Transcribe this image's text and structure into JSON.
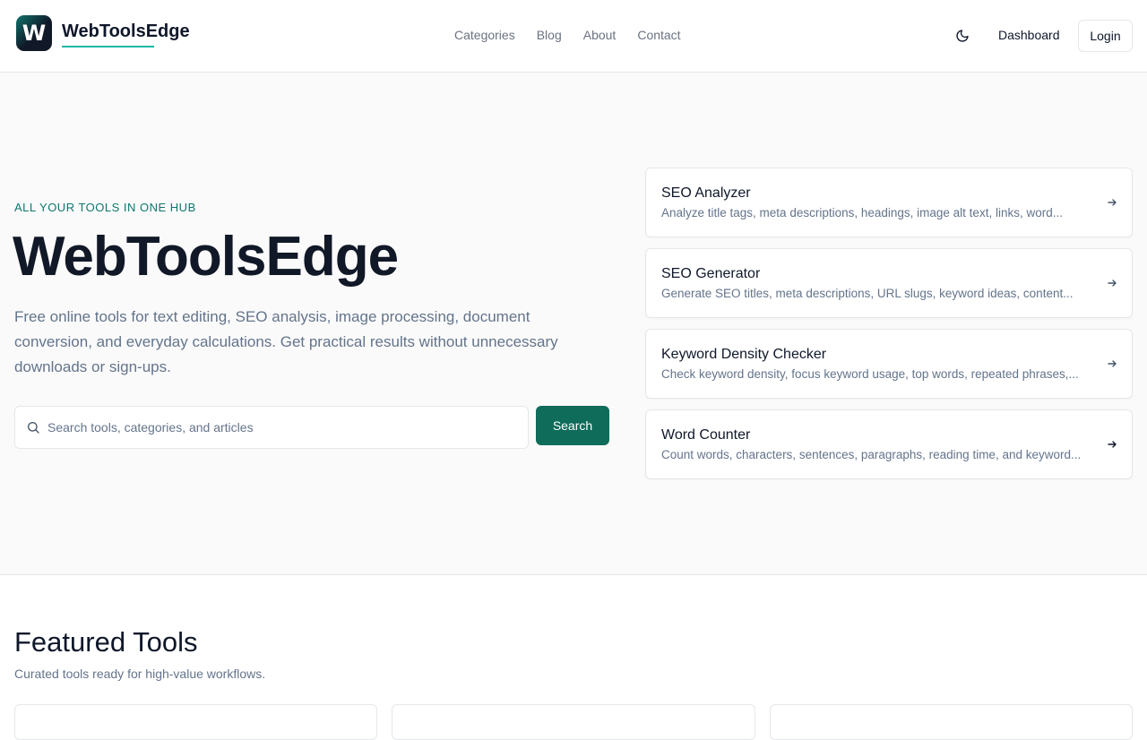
{
  "brand": {
    "logo_letter": "W",
    "name": "WebToolsEdge"
  },
  "nav": {
    "items": [
      "Categories",
      "Blog",
      "About",
      "Contact"
    ]
  },
  "header": {
    "theme_icon": "moon-icon",
    "dashboard_label": "Dashboard",
    "login_label": "Login"
  },
  "hero": {
    "eyebrow": "ALL YOUR TOOLS IN ONE HUB",
    "title": "WebToolsEdge",
    "description": "Free online tools for text editing, SEO analysis, image processing, document conversion, and everyday calculations. Get practical results without unnecessary downloads or sign-ups.",
    "search_placeholder": "Search tools, categories, and articles",
    "search_button": "Search"
  },
  "tools": [
    {
      "name": "SEO Analyzer",
      "desc": "Analyze title tags, meta descriptions, headings, image alt text, links, word..."
    },
    {
      "name": "SEO Generator",
      "desc": "Generate SEO titles, meta descriptions, URL slugs, keyword ideas, content..."
    },
    {
      "name": "Keyword Density Checker",
      "desc": "Check keyword density, focus keyword usage, top words, repeated phrases,..."
    },
    {
      "name": "Word Counter",
      "desc": "Count words, characters, sentences, paragraphs, reading time, and keyword..."
    }
  ],
  "featured": {
    "title": "Featured Tools",
    "subtitle": "Curated tools ready for high-value workflows."
  },
  "colors": {
    "accent": "#0f766e",
    "button": "#0f6b5a",
    "underline": "#14b8a6"
  }
}
